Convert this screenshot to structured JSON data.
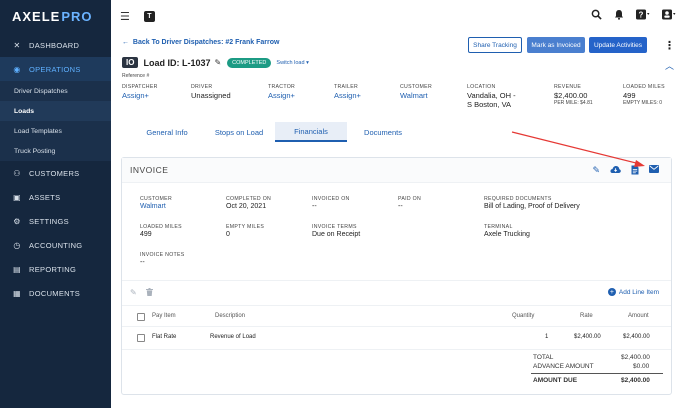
{
  "brand": {
    "name": "AXELE",
    "suffix": "PRO"
  },
  "sidebar": {
    "items": [
      {
        "label": "DASHBOARD",
        "icon": "x-icon"
      },
      {
        "label": "OPERATIONS",
        "icon": "globe-icon"
      },
      {
        "label": "CUSTOMERS",
        "icon": "people-icon"
      },
      {
        "label": "ASSETS",
        "icon": "truck-icon"
      },
      {
        "label": "SETTINGS",
        "icon": "gear-icon"
      },
      {
        "label": "ACCOUNTING",
        "icon": "clock-icon"
      },
      {
        "label": "REPORTING",
        "icon": "report-icon"
      },
      {
        "label": "DOCUMENTS",
        "icon": "document-icon"
      }
    ],
    "subitems": [
      "Driver Dispatches",
      "Loads",
      "Load Templates",
      "Truck Posting"
    ]
  },
  "topbar": {
    "logo_letter": "T"
  },
  "header": {
    "back_label": "Back To Driver Dispatches: #2 Frank Farrow",
    "buttons": {
      "share": "Share Tracking",
      "invoiced": "Mark as Invoiced",
      "update": "Update Activities"
    },
    "badge": "IO",
    "load_id": "Load ID: L-1037",
    "status": "COMPLETED",
    "switch_load": "Switch load",
    "reference": "Reference #"
  },
  "info": {
    "dispatcher": {
      "label": "DISPATCHER",
      "value": "Assign"
    },
    "driver": {
      "label": "DRIVER",
      "value": "Unassigned"
    },
    "tractor": {
      "label": "TRACTOR",
      "value": "Assign"
    },
    "trailer": {
      "label": "TRAILER",
      "value": "Assign"
    },
    "customer": {
      "label": "CUSTOMER",
      "value": "Walmart"
    },
    "location": {
      "label": "LOCATION",
      "value1": "Vandalia, OH -",
      "value2": "S Boston, VA"
    },
    "revenue": {
      "label": "REVENUE",
      "value": "$2,400.00",
      "sub": "PER MILE: $4.81"
    },
    "loaded_miles": {
      "label": "LOADED MILES",
      "value": "499",
      "sub": "EMPTY MILES: 0"
    }
  },
  "tabs": [
    "General Info",
    "Stops on Load",
    "Financials",
    "Documents"
  ],
  "invoice": {
    "title": "INVOICE",
    "fields": {
      "customer": {
        "label": "CUSTOMER",
        "value": "Walmart"
      },
      "completed_on": {
        "label": "COMPLETED ON",
        "value": "Oct 20, 2021"
      },
      "invoiced_on": {
        "label": "INVOICED ON",
        "value": "--"
      },
      "paid_on": {
        "label": "PAID ON",
        "value": "--"
      },
      "required_docs": {
        "label": "REQUIRED DOCUMENTS",
        "value": "Bill of Lading, Proof of Delivery"
      },
      "loaded_miles": {
        "label": "LOADED MILES",
        "value": "499"
      },
      "empty_miles": {
        "label": "EMPTY MILES",
        "value": "0"
      },
      "invoice_terms": {
        "label": "INVOICE TERMS",
        "value": "Due on Receipt"
      },
      "terminal": {
        "label": "TERMINAL",
        "value": "Axele Trucking"
      },
      "invoice_notes": {
        "label": "INVOICE NOTES",
        "value": "--"
      }
    },
    "add_line_label": "Add Line Item",
    "table": {
      "headers": [
        "Pay Item",
        "Description",
        "Quantity",
        "Rate",
        "Amount"
      ],
      "rows": [
        {
          "pay_item": "Flat Rate",
          "description": "Revenue of Load",
          "quantity": "1",
          "rate": "$2,400.00",
          "amount": "$2,400.00"
        }
      ]
    },
    "totals": {
      "total_label": "TOTAL",
      "total_value": "$2,400.00",
      "advance_label": "ADVANCE AMOUNT",
      "advance_value": "$0.00",
      "due_label": "AMOUNT DUE",
      "due_value": "$2,400.00"
    }
  },
  "colors": {
    "sidebar": "#15273e",
    "accent": "#1f5fb0",
    "completed": "#1c9b84",
    "arrow": "#e53935"
  }
}
